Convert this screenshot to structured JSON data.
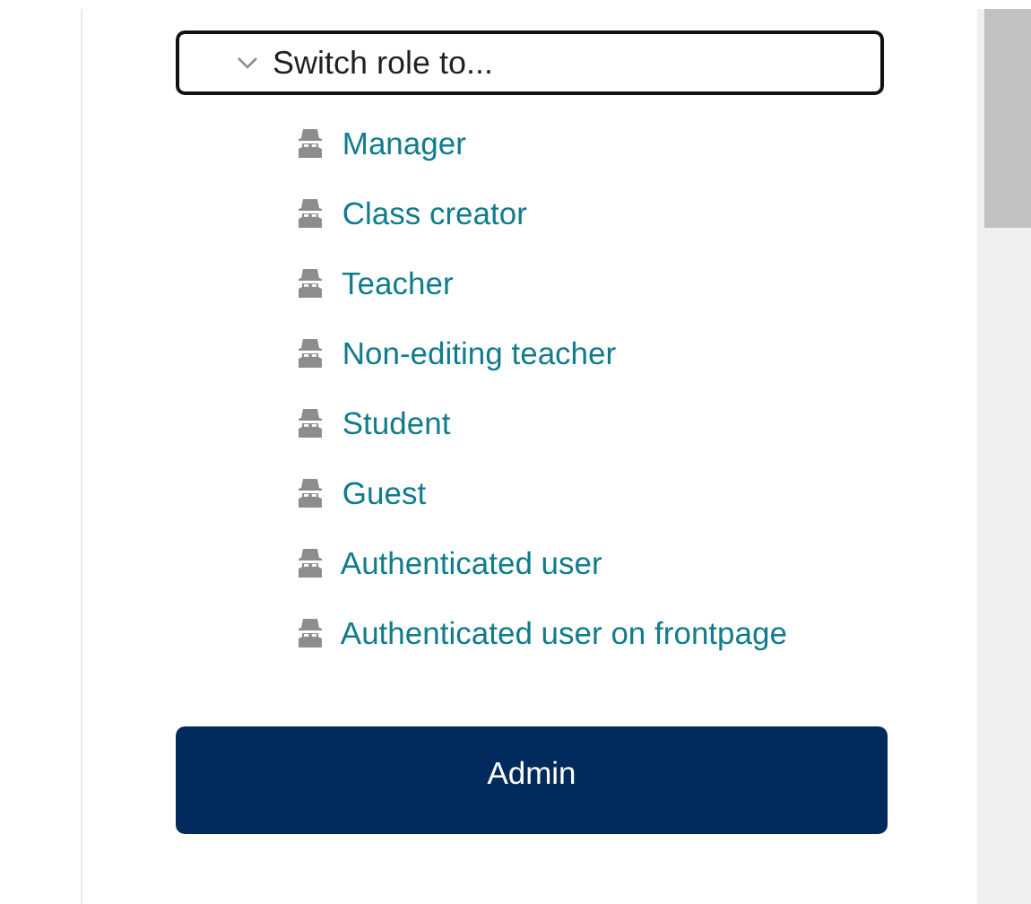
{
  "menu": {
    "heading": "Switch role to...",
    "expanded": true,
    "roles": [
      {
        "label": "Manager"
      },
      {
        "label": "Class creator"
      },
      {
        "label": "Teacher"
      },
      {
        "label": "Non-editing teacher"
      },
      {
        "label": "Student"
      },
      {
        "label": "Guest"
      },
      {
        "label": "Authenticated user"
      },
      {
        "label": "Authenticated user on frontpage"
      }
    ]
  },
  "button": {
    "label": "Admin"
  }
}
